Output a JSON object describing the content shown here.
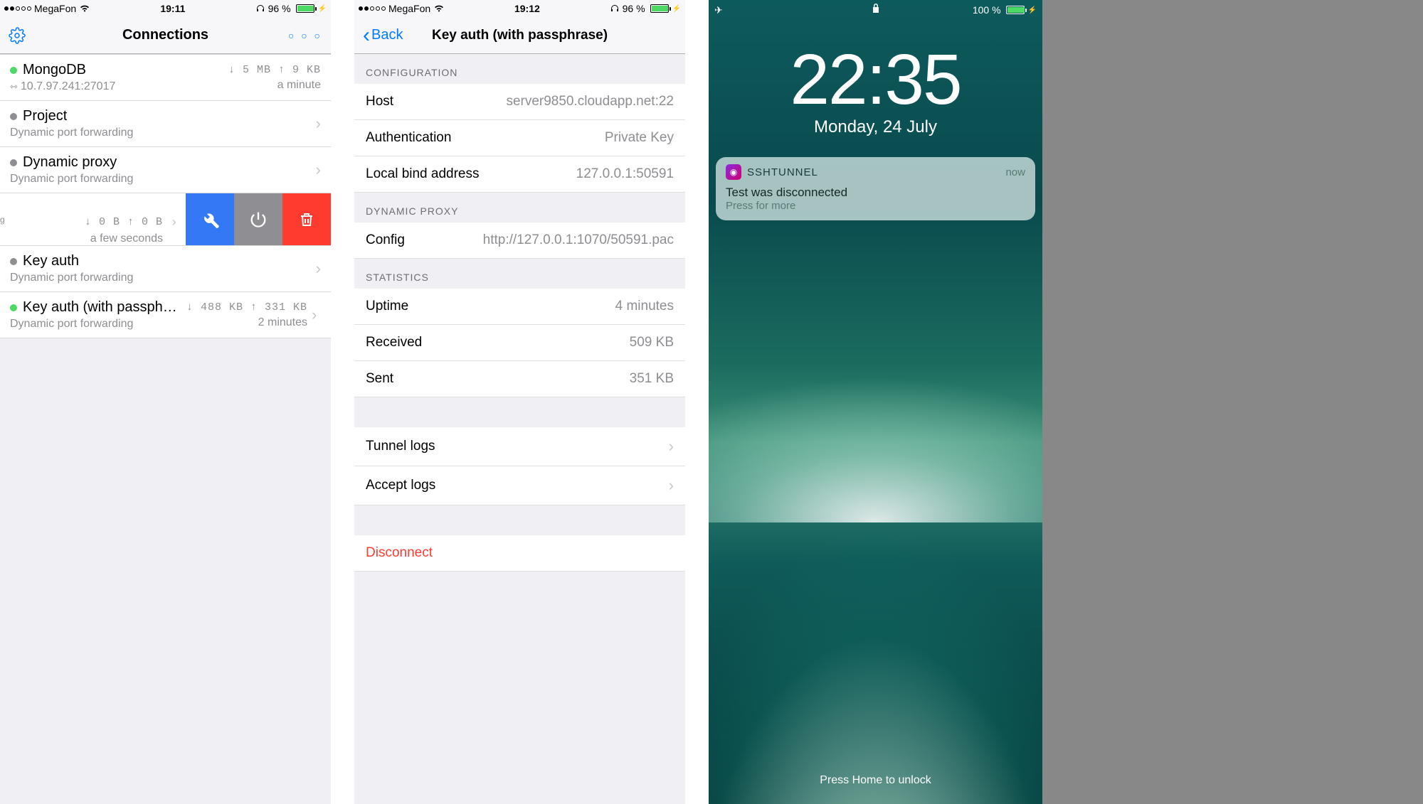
{
  "screen1": {
    "statusbar": {
      "carrier": "MegaFon",
      "time": "19:11",
      "battery_pct": "96 %",
      "battery_fill": 96
    },
    "nav": {
      "title": "Connections"
    },
    "items": [
      {
        "status": "green",
        "title": "MongoDB",
        "sub_icon": "resize",
        "sub": "10.7.97.241:27017",
        "traffic": "↓ 5 MB ↑ 9 KB",
        "time": "a minute"
      },
      {
        "status": "gray",
        "title": "Project",
        "sub": "Dynamic port forwarding"
      },
      {
        "status": "gray",
        "title": "Dynamic proxy",
        "sub": "Dynamic port forwarding"
      },
      {
        "swiped": true,
        "left_edge": "g",
        "traffic": "↓ 0 B ↑ 0 B",
        "time": "a few seconds"
      },
      {
        "status": "gray",
        "title": "Key auth",
        "sub": "Dynamic port forwarding"
      },
      {
        "status": "green",
        "title": "Key auth (with passphrase)",
        "sub": "Dynamic port forwarding",
        "traffic": "↓ 488 KB ↑ 331 KB",
        "time": "2 minutes"
      }
    ]
  },
  "screen2": {
    "statusbar": {
      "carrier": "MegaFon",
      "time": "19:12",
      "battery_pct": "96 %",
      "battery_fill": 96
    },
    "nav": {
      "back": "Back",
      "title": "Key auth (with passphrase)"
    },
    "sections": {
      "configuration": {
        "header": "CONFIGURATION",
        "rows": [
          {
            "label": "Host",
            "value": "server9850.cloudapp.net:22"
          },
          {
            "label": "Authentication",
            "value": "Private Key"
          },
          {
            "label": "Local bind address",
            "value": "127.0.0.1:50591"
          }
        ]
      },
      "proxy": {
        "header": "DYNAMIC PROXY",
        "rows": [
          {
            "label": "Config",
            "value": "http://127.0.0.1:1070/50591.pac"
          }
        ]
      },
      "stats": {
        "header": "STATISTICS",
        "rows": [
          {
            "label": "Uptime",
            "value": "4 minutes"
          },
          {
            "label": "Received",
            "value": "509 KB"
          },
          {
            "label": "Sent",
            "value": "351 KB"
          }
        ]
      },
      "logs": {
        "rows": [
          {
            "label": "Tunnel logs"
          },
          {
            "label": "Accept logs"
          }
        ]
      },
      "disconnect": {
        "label": "Disconnect"
      }
    }
  },
  "screen3": {
    "statusbar": {
      "battery_pct": "100 %",
      "battery_fill": 100
    },
    "clock": {
      "time": "22:35",
      "date": "Monday, 24 July"
    },
    "notification": {
      "app": "SSHTUNNEL",
      "time": "now",
      "title": "Test was disconnected",
      "sub": "Press for more"
    },
    "unlock": "Press Home to unlock"
  }
}
